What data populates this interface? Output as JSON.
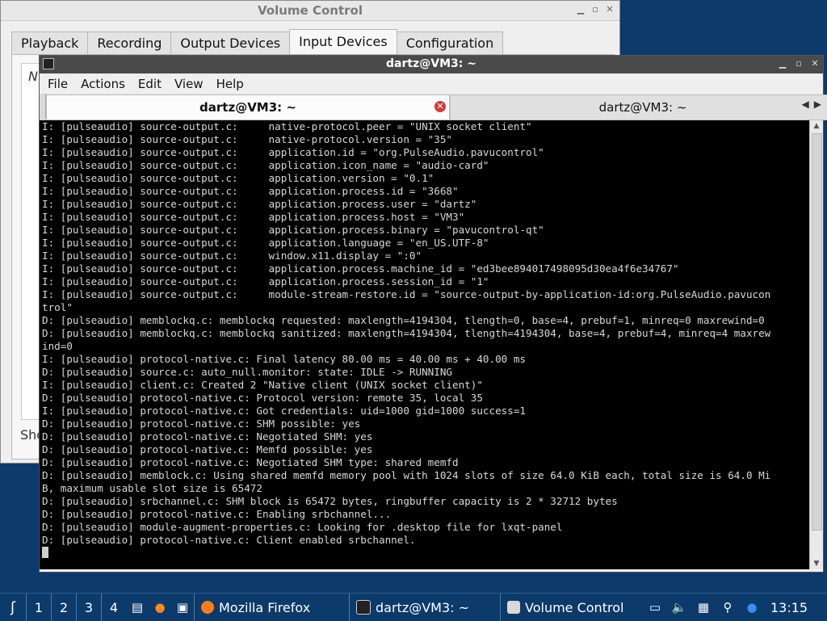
{
  "volume_control": {
    "title": "Volume Control",
    "tabs": [
      "Playback",
      "Recording",
      "Output Devices",
      "Input Devices",
      "Configuration"
    ],
    "active_tab": "Input Devices",
    "fragment_top": "N",
    "fragment_bottom": "Sho"
  },
  "terminal": {
    "title": "dartz@VM3: ~",
    "menu": [
      "File",
      "Actions",
      "Edit",
      "View",
      "Help"
    ],
    "tabs": [
      {
        "label": "dartz@VM3: ~"
      },
      {
        "label": "dartz@VM3: ~"
      }
    ],
    "lines": [
      "I: [pulseaudio] source-output.c:     native-protocol.peer = \"UNIX socket client\"",
      "I: [pulseaudio] source-output.c:     native-protocol.version = \"35\"",
      "I: [pulseaudio] source-output.c:     application.id = \"org.PulseAudio.pavucontrol\"",
      "I: [pulseaudio] source-output.c:     application.icon_name = \"audio-card\"",
      "I: [pulseaudio] source-output.c:     application.version = \"0.1\"",
      "I: [pulseaudio] source-output.c:     application.process.id = \"3668\"",
      "I: [pulseaudio] source-output.c:     application.process.user = \"dartz\"",
      "I: [pulseaudio] source-output.c:     application.process.host = \"VM3\"",
      "I: [pulseaudio] source-output.c:     application.process.binary = \"pavucontrol-qt\"",
      "I: [pulseaudio] source-output.c:     application.language = \"en_US.UTF-8\"",
      "I: [pulseaudio] source-output.c:     window.x11.display = \":0\"",
      "I: [pulseaudio] source-output.c:     application.process.machine_id = \"ed3bee894017498095d30ea4f6e34767\"",
      "I: [pulseaudio] source-output.c:     application.process.session_id = \"1\"",
      "I: [pulseaudio] source-output.c:     module-stream-restore.id = \"source-output-by-application-id:org.PulseAudio.pavucon",
      "trol\"",
      "D: [pulseaudio] memblockq.c: memblockq requested: maxlength=4194304, tlength=0, base=4, prebuf=1, minreq=0 maxrewind=0",
      "D: [pulseaudio] memblockq.c: memblockq sanitized: maxlength=4194304, tlength=4194304, base=4, prebuf=4, minreq=4 maxrew",
      "ind=0",
      "I: [pulseaudio] protocol-native.c: Final latency 80.00 ms = 40.00 ms + 40.00 ms",
      "D: [pulseaudio] source.c: auto_null.monitor: state: IDLE -> RUNNING",
      "I: [pulseaudio] client.c: Created 2 \"Native client (UNIX socket client)\"",
      "D: [pulseaudio] protocol-native.c: Protocol version: remote 35, local 35",
      "I: [pulseaudio] protocol-native.c: Got credentials: uid=1000 gid=1000 success=1",
      "D: [pulseaudio] protocol-native.c: SHM possible: yes",
      "D: [pulseaudio] protocol-native.c: Negotiated SHM: yes",
      "D: [pulseaudio] protocol-native.c: Memfd possible: yes",
      "D: [pulseaudio] protocol-native.c: Negotiated SHM type: shared memfd",
      "D: [pulseaudio] memblock.c: Using shared memfd memory pool with 1024 slots of size 64.0 KiB each, total size is 64.0 Mi",
      "B, maximum usable slot size is 65472",
      "D: [pulseaudio] srbchannel.c: SHM block is 65472 bytes, ringbuffer capacity is 2 * 32712 bytes",
      "D: [pulseaudio] protocol-native.c: Enabling srbchannel...",
      "D: [pulseaudio] module-augment-properties.c: Looking for .desktop file for lxqt-panel",
      "D: [pulseaudio] protocol-native.c: Client enabled srbchannel."
    ]
  },
  "taskbar": {
    "desktops": [
      "1",
      "2",
      "3",
      "4"
    ],
    "tasks": [
      {
        "label": "Mozilla Firefox",
        "icon": "firefox-icon"
      },
      {
        "label": "dartz@VM3: ~",
        "icon": "terminal-icon"
      },
      {
        "label": "Volume Control",
        "icon": "volume-control-icon"
      }
    ],
    "clock": "13:15"
  }
}
